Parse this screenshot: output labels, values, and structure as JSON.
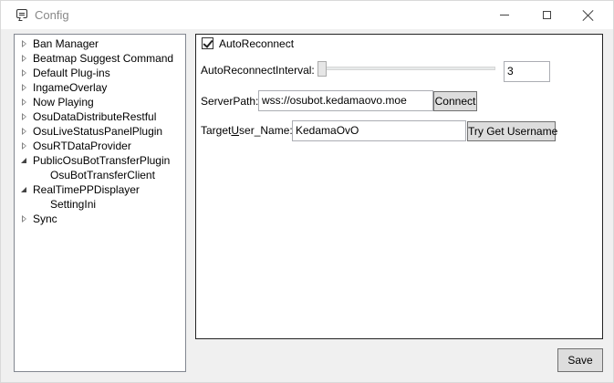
{
  "window": {
    "title": "Config"
  },
  "tree": {
    "items": [
      {
        "label": "Ban Manager",
        "state": "collapsed",
        "level": 0
      },
      {
        "label": "Beatmap Suggest Command",
        "state": "collapsed",
        "level": 0
      },
      {
        "label": "Default Plug-ins",
        "state": "collapsed",
        "level": 0
      },
      {
        "label": "IngameOverlay",
        "state": "collapsed",
        "level": 0
      },
      {
        "label": "Now Playing",
        "state": "collapsed",
        "level": 0
      },
      {
        "label": "OsuDataDistributeRestful",
        "state": "collapsed",
        "level": 0
      },
      {
        "label": "OsuLiveStatusPanelPlugin",
        "state": "collapsed",
        "level": 0
      },
      {
        "label": "OsuRTDataProvider",
        "state": "collapsed",
        "level": 0
      },
      {
        "label": "PublicOsuBotTransferPlugin",
        "state": "expanded",
        "level": 0
      },
      {
        "label": "OsuBotTransferClient",
        "state": "leaf",
        "level": 1
      },
      {
        "label": "RealTimePPDisplayer",
        "state": "expanded",
        "level": 0
      },
      {
        "label": "SettingIni",
        "state": "leaf",
        "level": 1
      },
      {
        "label": "Sync",
        "state": "collapsed",
        "level": 0
      }
    ]
  },
  "settings": {
    "auto_reconnect_label": "AutoReconnect",
    "auto_reconnect_checked": true,
    "interval_label": "AutoReconnectInterval:",
    "interval_value": "3",
    "interval_slider_fraction": 0.0,
    "server_path_label": "ServerPath:",
    "server_path_value": "wss://osubot.kedamaovo.moe",
    "connect_label": "Connect",
    "username_label_prefix": "Target",
    "username_label_underlined": "U",
    "username_label_suffix": "ser_Name:",
    "username_value": "KedamaOvO",
    "get_username_label": "Try Get Username"
  },
  "footer": {
    "save_label": "Save"
  }
}
